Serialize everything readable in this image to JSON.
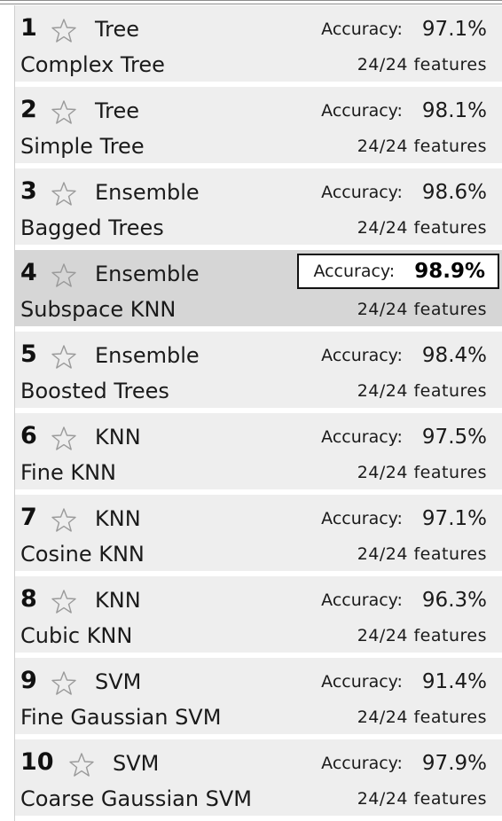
{
  "accuracy_label": "Accuracy:",
  "colors": {
    "row_background": "#eeeeee",
    "selected_row_background": "#d6d6d6",
    "star_outline": "#9a9a9a"
  },
  "models": [
    {
      "rank": "1",
      "category": "Tree",
      "name": "Complex Tree",
      "accuracy": "97.1%",
      "features": "24/24 features",
      "starred": false,
      "selected": false
    },
    {
      "rank": "2",
      "category": "Tree",
      "name": "Simple Tree",
      "accuracy": "98.1%",
      "features": "24/24 features",
      "starred": false,
      "selected": false
    },
    {
      "rank": "3",
      "category": "Ensemble",
      "name": "Bagged Trees",
      "accuracy": "98.6%",
      "features": "24/24 features",
      "starred": false,
      "selected": false
    },
    {
      "rank": "4",
      "category": "Ensemble",
      "name": "Subspace KNN",
      "accuracy": "98.9%",
      "features": "24/24 features",
      "starred": false,
      "selected": true
    },
    {
      "rank": "5",
      "category": "Ensemble",
      "name": "Boosted Trees",
      "accuracy": "98.4%",
      "features": "24/24 features",
      "starred": false,
      "selected": false
    },
    {
      "rank": "6",
      "category": "KNN",
      "name": "Fine KNN",
      "accuracy": "97.5%",
      "features": "24/24 features",
      "starred": false,
      "selected": false
    },
    {
      "rank": "7",
      "category": "KNN",
      "name": "Cosine KNN",
      "accuracy": "97.1%",
      "features": "24/24 features",
      "starred": false,
      "selected": false
    },
    {
      "rank": "8",
      "category": "KNN",
      "name": "Cubic KNN",
      "accuracy": "96.3%",
      "features": "24/24 features",
      "starred": false,
      "selected": false
    },
    {
      "rank": "9",
      "category": "SVM",
      "name": "Fine Gaussian SVM",
      "accuracy": "91.4%",
      "features": "24/24 features",
      "starred": false,
      "selected": false
    },
    {
      "rank": "10",
      "category": "SVM",
      "name": "Coarse Gaussian SVM",
      "accuracy": "97.9%",
      "features": "24/24 features",
      "starred": false,
      "selected": false
    }
  ]
}
